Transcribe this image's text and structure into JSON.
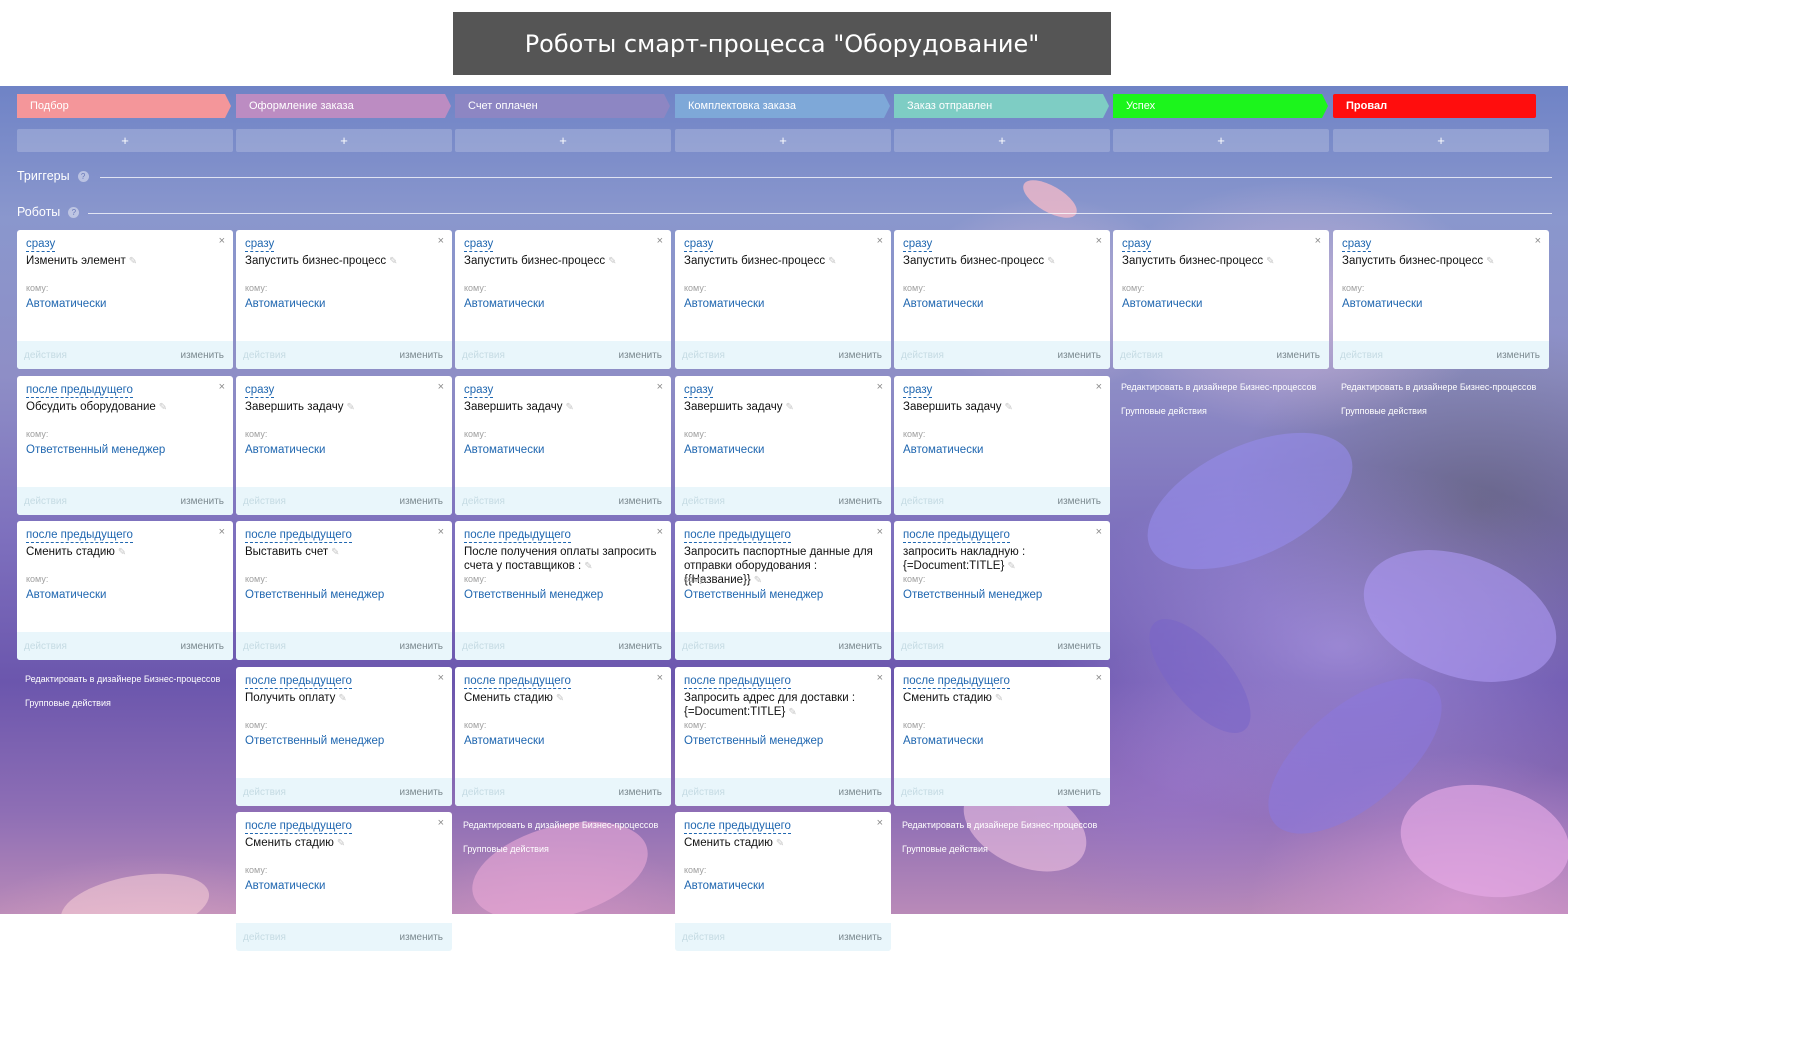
{
  "page": {
    "title": "Роботы смарт-процесса \"Оборудование\""
  },
  "stages": [
    {
      "label": "Подбор",
      "color": "#f4969a"
    },
    {
      "label": "Оформление заказа",
      "color": "#bc8cc2"
    },
    {
      "label": "Счет оплачен",
      "color": "#8d86c3"
    },
    {
      "label": "Комплектовка заказа",
      "color": "#7ea8d8"
    },
    {
      "label": "Заказ отправлен",
      "color": "#7ecdc4"
    },
    {
      "label": "Успех",
      "color": "#1cf51c"
    },
    {
      "label": "Провал",
      "color": "#ff0d0d"
    }
  ],
  "add_label": "+",
  "sections": {
    "triggers": "Триггеры",
    "robots": "Роботы",
    "help": "?"
  },
  "card_labels": {
    "to": "кому:",
    "actions": "действия",
    "edit": "изменить",
    "close": "×",
    "pen": "✎"
  },
  "links": {
    "designer": "Редактировать в дизайнере Бизнес-процессов",
    "group": "Групповые действия"
  },
  "columns": [
    {
      "robots": [
        {
          "when": "сразу",
          "name": "Изменить элемент",
          "to": "Автоматически"
        },
        {
          "when": "после предыдущего",
          "name": "Обсудить оборудование",
          "to": "Ответственный менеджер"
        },
        {
          "when": "после предыдущего",
          "name": "Сменить стадию",
          "to": "Автоматически"
        }
      ]
    },
    {
      "robots": [
        {
          "when": "сразу",
          "name": "Запустить бизнес-процесс",
          "to": "Автоматически"
        },
        {
          "when": "сразу",
          "name": "Завершить задачу",
          "to": "Автоматически"
        },
        {
          "when": "после предыдущего",
          "name": "Выставить счет",
          "to": "Ответственный менеджер"
        },
        {
          "when": "после предыдущего",
          "name": "Получить оплату",
          "to": "Ответственный менеджер"
        },
        {
          "when": "после предыдущего",
          "name": "Сменить стадию",
          "to": "Автоматически"
        }
      ]
    },
    {
      "robots": [
        {
          "when": "сразу",
          "name": "Запустить бизнес-процесс",
          "to": "Автоматически"
        },
        {
          "when": "сразу",
          "name": "Завершить задачу",
          "to": "Автоматически"
        },
        {
          "when": "после предыдущего",
          "name": "После получения оплаты запросить счета у поставщиков :",
          "to": "Ответственный менеджер"
        },
        {
          "when": "после предыдущего",
          "name": "Сменить стадию",
          "to": "Автоматически"
        }
      ]
    },
    {
      "robots": [
        {
          "when": "сразу",
          "name": "Запустить бизнес-процесс",
          "to": "Автоматически"
        },
        {
          "when": "сразу",
          "name": "Завершить задачу",
          "to": "Автоматически"
        },
        {
          "when": "после предыдущего",
          "name": "Запросить паспортные данные для отправки оборудования : {{Название}}",
          "to": "Ответственный менеджер"
        },
        {
          "when": "после предыдущего",
          "name": "Запросить адрес для доставки : {=Document:TITLE}",
          "to": "Ответственный менеджер"
        },
        {
          "when": "после предыдущего",
          "name": "Сменить стадию",
          "to": "Автоматически"
        }
      ]
    },
    {
      "robots": [
        {
          "when": "сразу",
          "name": "Запустить бизнес-процесс",
          "to": "Автоматически"
        },
        {
          "when": "сразу",
          "name": "Завершить задачу",
          "to": "Автоматически"
        },
        {
          "when": "после предыдущего",
          "name": "запросить накладную : {=Document:TITLE}",
          "to": "Ответственный менеджер"
        },
        {
          "when": "после предыдущего",
          "name": "Сменить стадию",
          "to": "Автоматически"
        }
      ]
    },
    {
      "robots": [
        {
          "when": "сразу",
          "name": "Запустить бизнес-процесс",
          "to": "Автоматически"
        }
      ]
    },
    {
      "robots": [
        {
          "when": "сразу",
          "name": "Запустить бизнес-процесс",
          "to": "Автоматически"
        }
      ]
    }
  ]
}
